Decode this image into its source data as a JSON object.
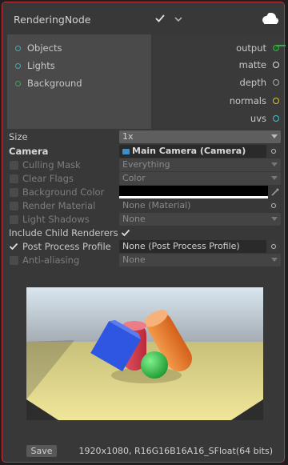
{
  "node": {
    "title": "RenderingNode",
    "icons": {
      "toggle": "check-icon",
      "collapse": "chevron-down-icon",
      "settings": "cloud-icon"
    }
  },
  "inputs": [
    {
      "label": "Objects",
      "color": "#4ea6b5"
    },
    {
      "label": "Lights",
      "color": "#4ea6b5"
    },
    {
      "label": "Background",
      "color": "#3fa64a"
    }
  ],
  "outputs": [
    {
      "label": "output",
      "color": "#3fa64a"
    },
    {
      "label": "matte",
      "color": "#cccccc"
    },
    {
      "label": "depth",
      "color": "#bbbbbb"
    },
    {
      "label": "normals",
      "color": "#d9c13a"
    },
    {
      "label": "uvs",
      "color": "#3fc3c9"
    }
  ],
  "properties": {
    "size": {
      "label": "Size",
      "value": "1x"
    },
    "camera": {
      "label": "Camera",
      "value": "Main Camera (Camera)"
    },
    "culling_mask": {
      "label": "Culling Mask",
      "value": "Everything"
    },
    "clear_flags": {
      "label": "Clear Flags",
      "value": "Color"
    },
    "background_color": {
      "label": "Background Color",
      "value": "#000000"
    },
    "render_material": {
      "label": "Render Material",
      "value": "None (Material)"
    },
    "light_shadows": {
      "label": "Light Shadows",
      "value": "None"
    },
    "include_child_renderers": {
      "label": "Include Child Renderers",
      "checked": true
    },
    "post_process_profile": {
      "label": "Post Process Profile",
      "value": "None (Post Process Profile)",
      "checked": true
    },
    "anti_aliasing": {
      "label": "Anti-aliasing",
      "value": "None"
    }
  },
  "preview": {
    "description_colors": {
      "floor": "#e6dc8a",
      "cube": "#2f56e0",
      "cylinder_orange": "#f07a2a",
      "cylinder_red": "#d83a4a",
      "sphere": "#3cc452"
    }
  },
  "footer": {
    "save_label": "Save",
    "format": "1920x1080, R16G16B16A16_SFloat(64 bits)"
  }
}
